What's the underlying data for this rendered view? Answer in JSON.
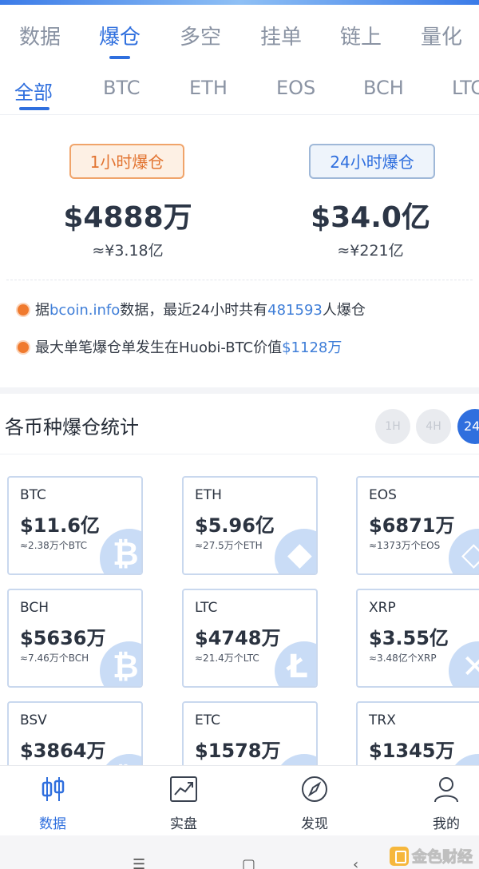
{
  "primary_tabs": [
    "数据",
    "爆仓",
    "多空",
    "挂单",
    "链上",
    "量化"
  ],
  "secondary_tabs": [
    "全部",
    "BTC",
    "ETH",
    "EOS",
    "BCH",
    "LTC"
  ],
  "summary": {
    "left_badge": "1小时爆仓",
    "left_value": "$4888万",
    "left_cny": "≈¥3.18亿",
    "right_badge": "24小时爆仓",
    "right_value": "$34.0亿",
    "right_cny": "≈¥221亿",
    "line1": {
      "a": "据",
      "b": "bcoin.info",
      "c": "数据，最近24小时共有",
      "d": "481593",
      "e": "人爆仓"
    },
    "line2": {
      "a": "最大单笔爆仓单发生在Huobi-BTC价值",
      "b": "$1128万"
    }
  },
  "stats": {
    "title": "各币种爆仓统计",
    "periods": [
      "1H",
      "4H",
      "24"
    ],
    "cards": [
      {
        "symbol": "BTC",
        "value": "$11.6亿",
        "sub": "≈2.38万个BTC",
        "icon": "bitcoin-icon"
      },
      {
        "symbol": "ETH",
        "value": "$5.96亿",
        "sub": "≈27.5万个ETH",
        "icon": "ethereum-icon"
      },
      {
        "symbol": "EOS",
        "value": "$6871万",
        "sub": "≈1373万个EOS",
        "icon": "eos-icon"
      },
      {
        "symbol": "BCH",
        "value": "$5636万",
        "sub": "≈7.46万个BCH",
        "icon": "bitcoin-cash-icon"
      },
      {
        "symbol": "LTC",
        "value": "$4748万",
        "sub": "≈21.4万个LTC",
        "icon": "litecoin-icon"
      },
      {
        "symbol": "XRP",
        "value": "$3.55亿",
        "sub": "≈3.48亿个XRP",
        "icon": "ripple-icon"
      },
      {
        "symbol": "BSV",
        "value": "$3864万",
        "icon": "bitcoin-sv-icon"
      },
      {
        "symbol": "ETC",
        "value": "$1578万",
        "icon": "ethereum-classic-icon"
      },
      {
        "symbol": "TRX",
        "value": "$1345万",
        "icon": "tron-icon"
      }
    ]
  },
  "bottom_nav": [
    "数据",
    "实盘",
    "发现",
    "我的"
  ],
  "watermark": "金色财经",
  "colors": {
    "accent": "#2f6fde",
    "orange": "#e27431",
    "card_border": "#c9d8ee"
  }
}
